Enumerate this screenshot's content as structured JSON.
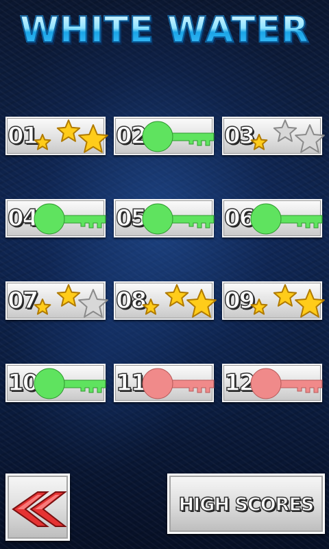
{
  "title": "WHITE WATER",
  "levels": [
    {
      "number": "01",
      "state": "stars",
      "stars": 3
    },
    {
      "number": "02",
      "state": "unlocked"
    },
    {
      "number": "03",
      "state": "stars",
      "stars": 1
    },
    {
      "number": "04",
      "state": "unlocked"
    },
    {
      "number": "05",
      "state": "unlocked"
    },
    {
      "number": "06",
      "state": "unlocked"
    },
    {
      "number": "07",
      "state": "stars",
      "stars": 2
    },
    {
      "number": "08",
      "state": "stars",
      "stars": 3
    },
    {
      "number": "09",
      "state": "stars",
      "stars": 3
    },
    {
      "number": "10",
      "state": "unlocked"
    },
    {
      "number": "11",
      "state": "locked"
    },
    {
      "number": "12",
      "state": "locked"
    }
  ],
  "buttons": {
    "back_icon": "double-chevron-left-icon",
    "high_scores_label": "HIGH SCORES"
  },
  "colors": {
    "key_unlocked": "#5fe35f",
    "key_locked": "#f08a8a",
    "star_gold": "#ffcc1a",
    "star_empty": "#d8d8d8",
    "back_arrow": "#e53333"
  }
}
